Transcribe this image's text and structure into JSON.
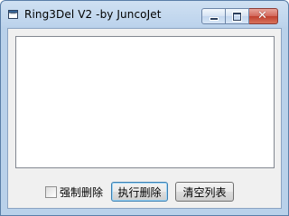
{
  "window": {
    "title": "Ring3Del V2 -by JuncoJet"
  },
  "titlebar_icons": {
    "app": "app-window-icon",
    "minimize": "minimize-icon",
    "maximize": "maximize-icon",
    "close": "close-icon"
  },
  "close_glyph": "✕",
  "listbox": {
    "items": []
  },
  "controls": {
    "force_delete_label": "强制删除",
    "force_delete_checked": false,
    "execute_delete_label": "执行删除",
    "clear_list_label": "清空列表"
  },
  "colors": {
    "close_button": "#c8473a",
    "accent_border": "#3c7fb1"
  }
}
